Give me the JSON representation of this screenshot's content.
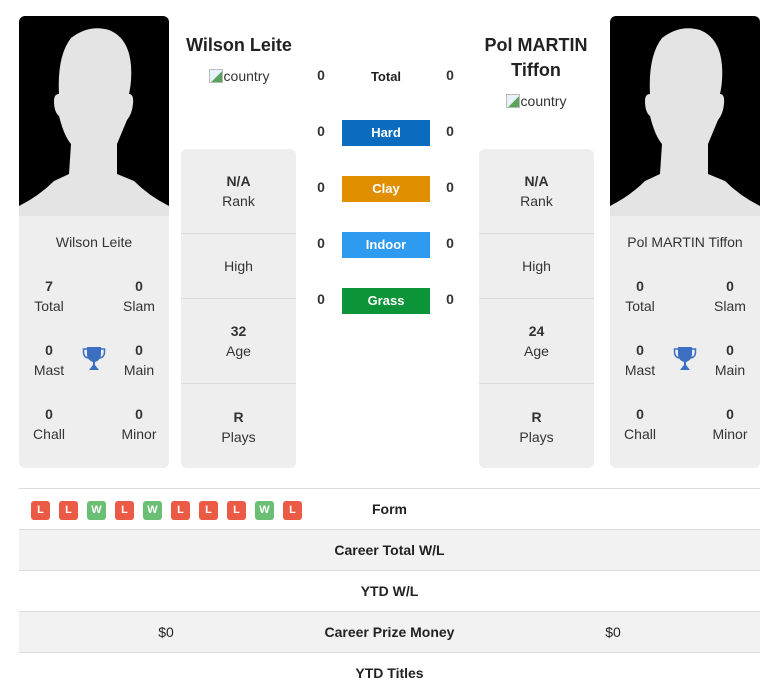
{
  "colors": {
    "hard": "#0a6bbf",
    "clay": "#e08f00",
    "indoor": "#2f9bf0",
    "grass": "#0b9438",
    "win": "#6bbf74",
    "loss": "#ea5a44",
    "trophy": "#3a6fc1"
  },
  "player1": {
    "name": "Wilson Leite",
    "country_alt": "country",
    "card_name": "Wilson Leite",
    "stats": {
      "total": {
        "value": "7",
        "label": "Total"
      },
      "slam": {
        "value": "0",
        "label": "Slam"
      },
      "mast": {
        "value": "0",
        "label": "Mast"
      },
      "main": {
        "value": "0",
        "label": "Main"
      },
      "chall": {
        "value": "0",
        "label": "Chall"
      },
      "minor": {
        "value": "0",
        "label": "Minor"
      }
    },
    "info": {
      "rank": {
        "value": "N/A",
        "label": "Rank"
      },
      "high": {
        "label": "High"
      },
      "age": {
        "value": "32",
        "label": "Age"
      },
      "plays": {
        "value": "R",
        "label": "Plays"
      }
    }
  },
  "player2": {
    "name": "Pol MARTIN Tiffon",
    "name_line1": "Pol MARTIN",
    "name_line2": "Tiffon",
    "country_alt": "country",
    "card_name": "Pol MARTIN Tiffon",
    "stats": {
      "total": {
        "value": "0",
        "label": "Total"
      },
      "slam": {
        "value": "0",
        "label": "Slam"
      },
      "mast": {
        "value": "0",
        "label": "Mast"
      },
      "main": {
        "value": "0",
        "label": "Main"
      },
      "chall": {
        "value": "0",
        "label": "Chall"
      },
      "minor": {
        "value": "0",
        "label": "Minor"
      }
    },
    "info": {
      "rank": {
        "value": "N/A",
        "label": "Rank"
      },
      "high": {
        "label": "High"
      },
      "age": {
        "value": "24",
        "label": "Age"
      },
      "plays": {
        "value": "R",
        "label": "Plays"
      }
    }
  },
  "surfaces": [
    {
      "label": "Total",
      "p1": "0",
      "p2": "0"
    },
    {
      "label": "Hard",
      "p1": "0",
      "p2": "0"
    },
    {
      "label": "Clay",
      "p1": "0",
      "p2": "0"
    },
    {
      "label": "Indoor",
      "p1": "0",
      "p2": "0"
    },
    {
      "label": "Grass",
      "p1": "0",
      "p2": "0"
    }
  ],
  "table": {
    "form_label": "Form",
    "form": [
      "L",
      "L",
      "W",
      "L",
      "W",
      "L",
      "L",
      "L",
      "W",
      "L"
    ],
    "rows": [
      {
        "label": "Career Total W/L",
        "p1": "",
        "p2": ""
      },
      {
        "label": "YTD W/L",
        "p1": "",
        "p2": ""
      },
      {
        "label": "Career Prize Money",
        "p1": "$0",
        "p2": "$0"
      },
      {
        "label": "YTD Titles",
        "p1": "",
        "p2": ""
      }
    ]
  }
}
